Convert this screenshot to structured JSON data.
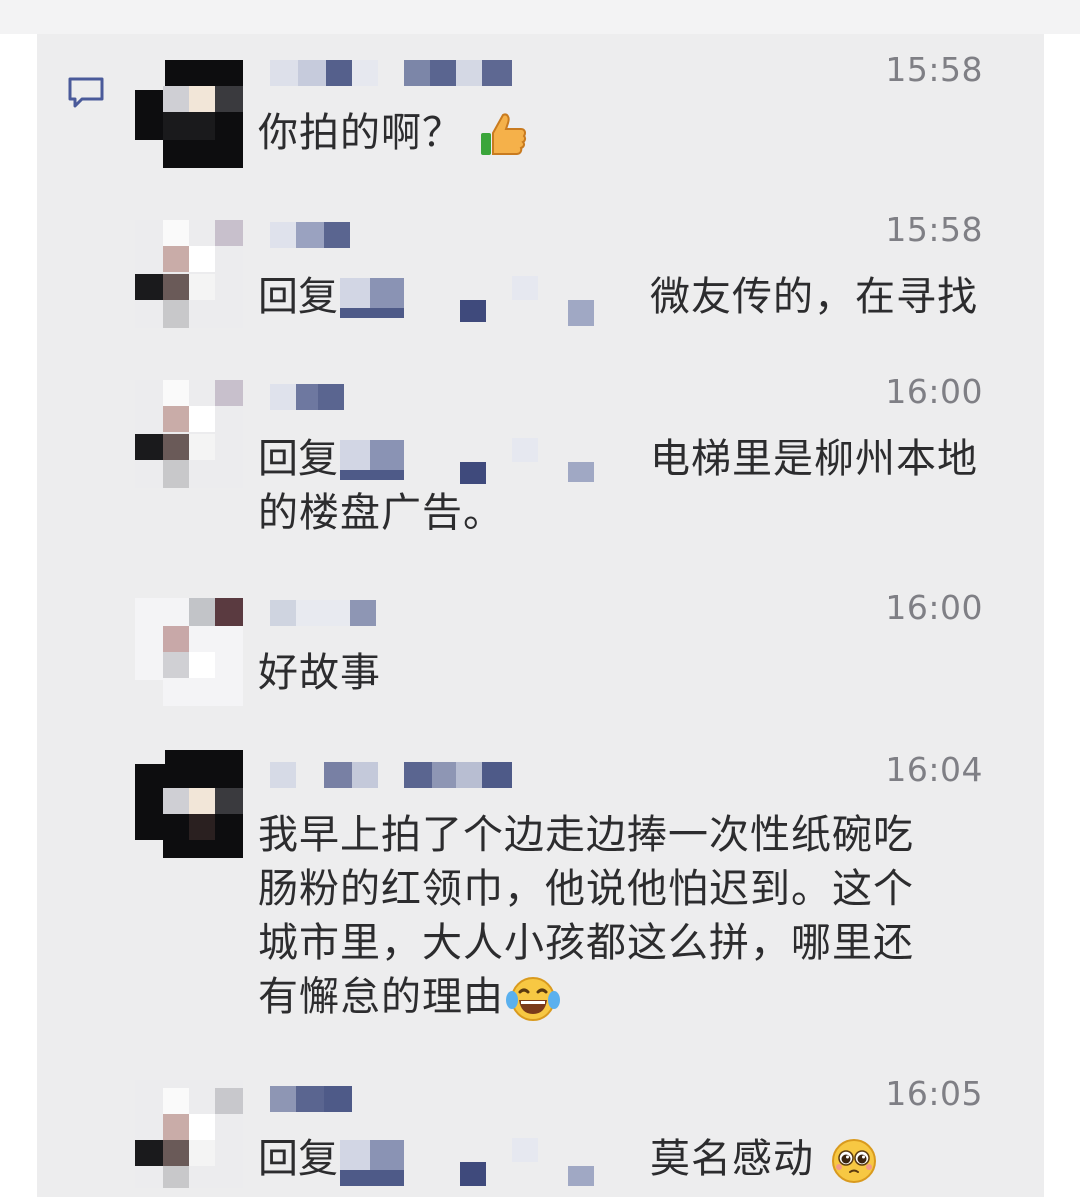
{
  "comments": [
    {
      "time": "15:58",
      "text": "你拍的啊？",
      "emoji": "thumbs-up"
    },
    {
      "time": "15:58",
      "reply_prefix": "回复",
      "text": "微友传的，在寻找"
    },
    {
      "time": "16:00",
      "reply_prefix": "回复",
      "text": "电梯里是柳州本地",
      "text_cont": "的楼盘广告。"
    },
    {
      "time": "16:00",
      "text": "好故事"
    },
    {
      "time": "16:04",
      "lines": [
        "我早上拍了个边走边捧一次性纸碗吃",
        "肠粉的红领巾，他说他怕迟到。这个",
        "城市里，大人小孩都这么拼，哪里还",
        "有懈怠的理由"
      ],
      "emoji": "laugh-cry"
    },
    {
      "time": "16:05",
      "reply_prefix": "回复",
      "text": "莫名感动",
      "emoji": "pleading-face"
    }
  ],
  "colors": {
    "panel_bg": "#ededee",
    "text": "#2c2c2e",
    "time": "#7f7f85",
    "icon": "#4a5a9a"
  }
}
